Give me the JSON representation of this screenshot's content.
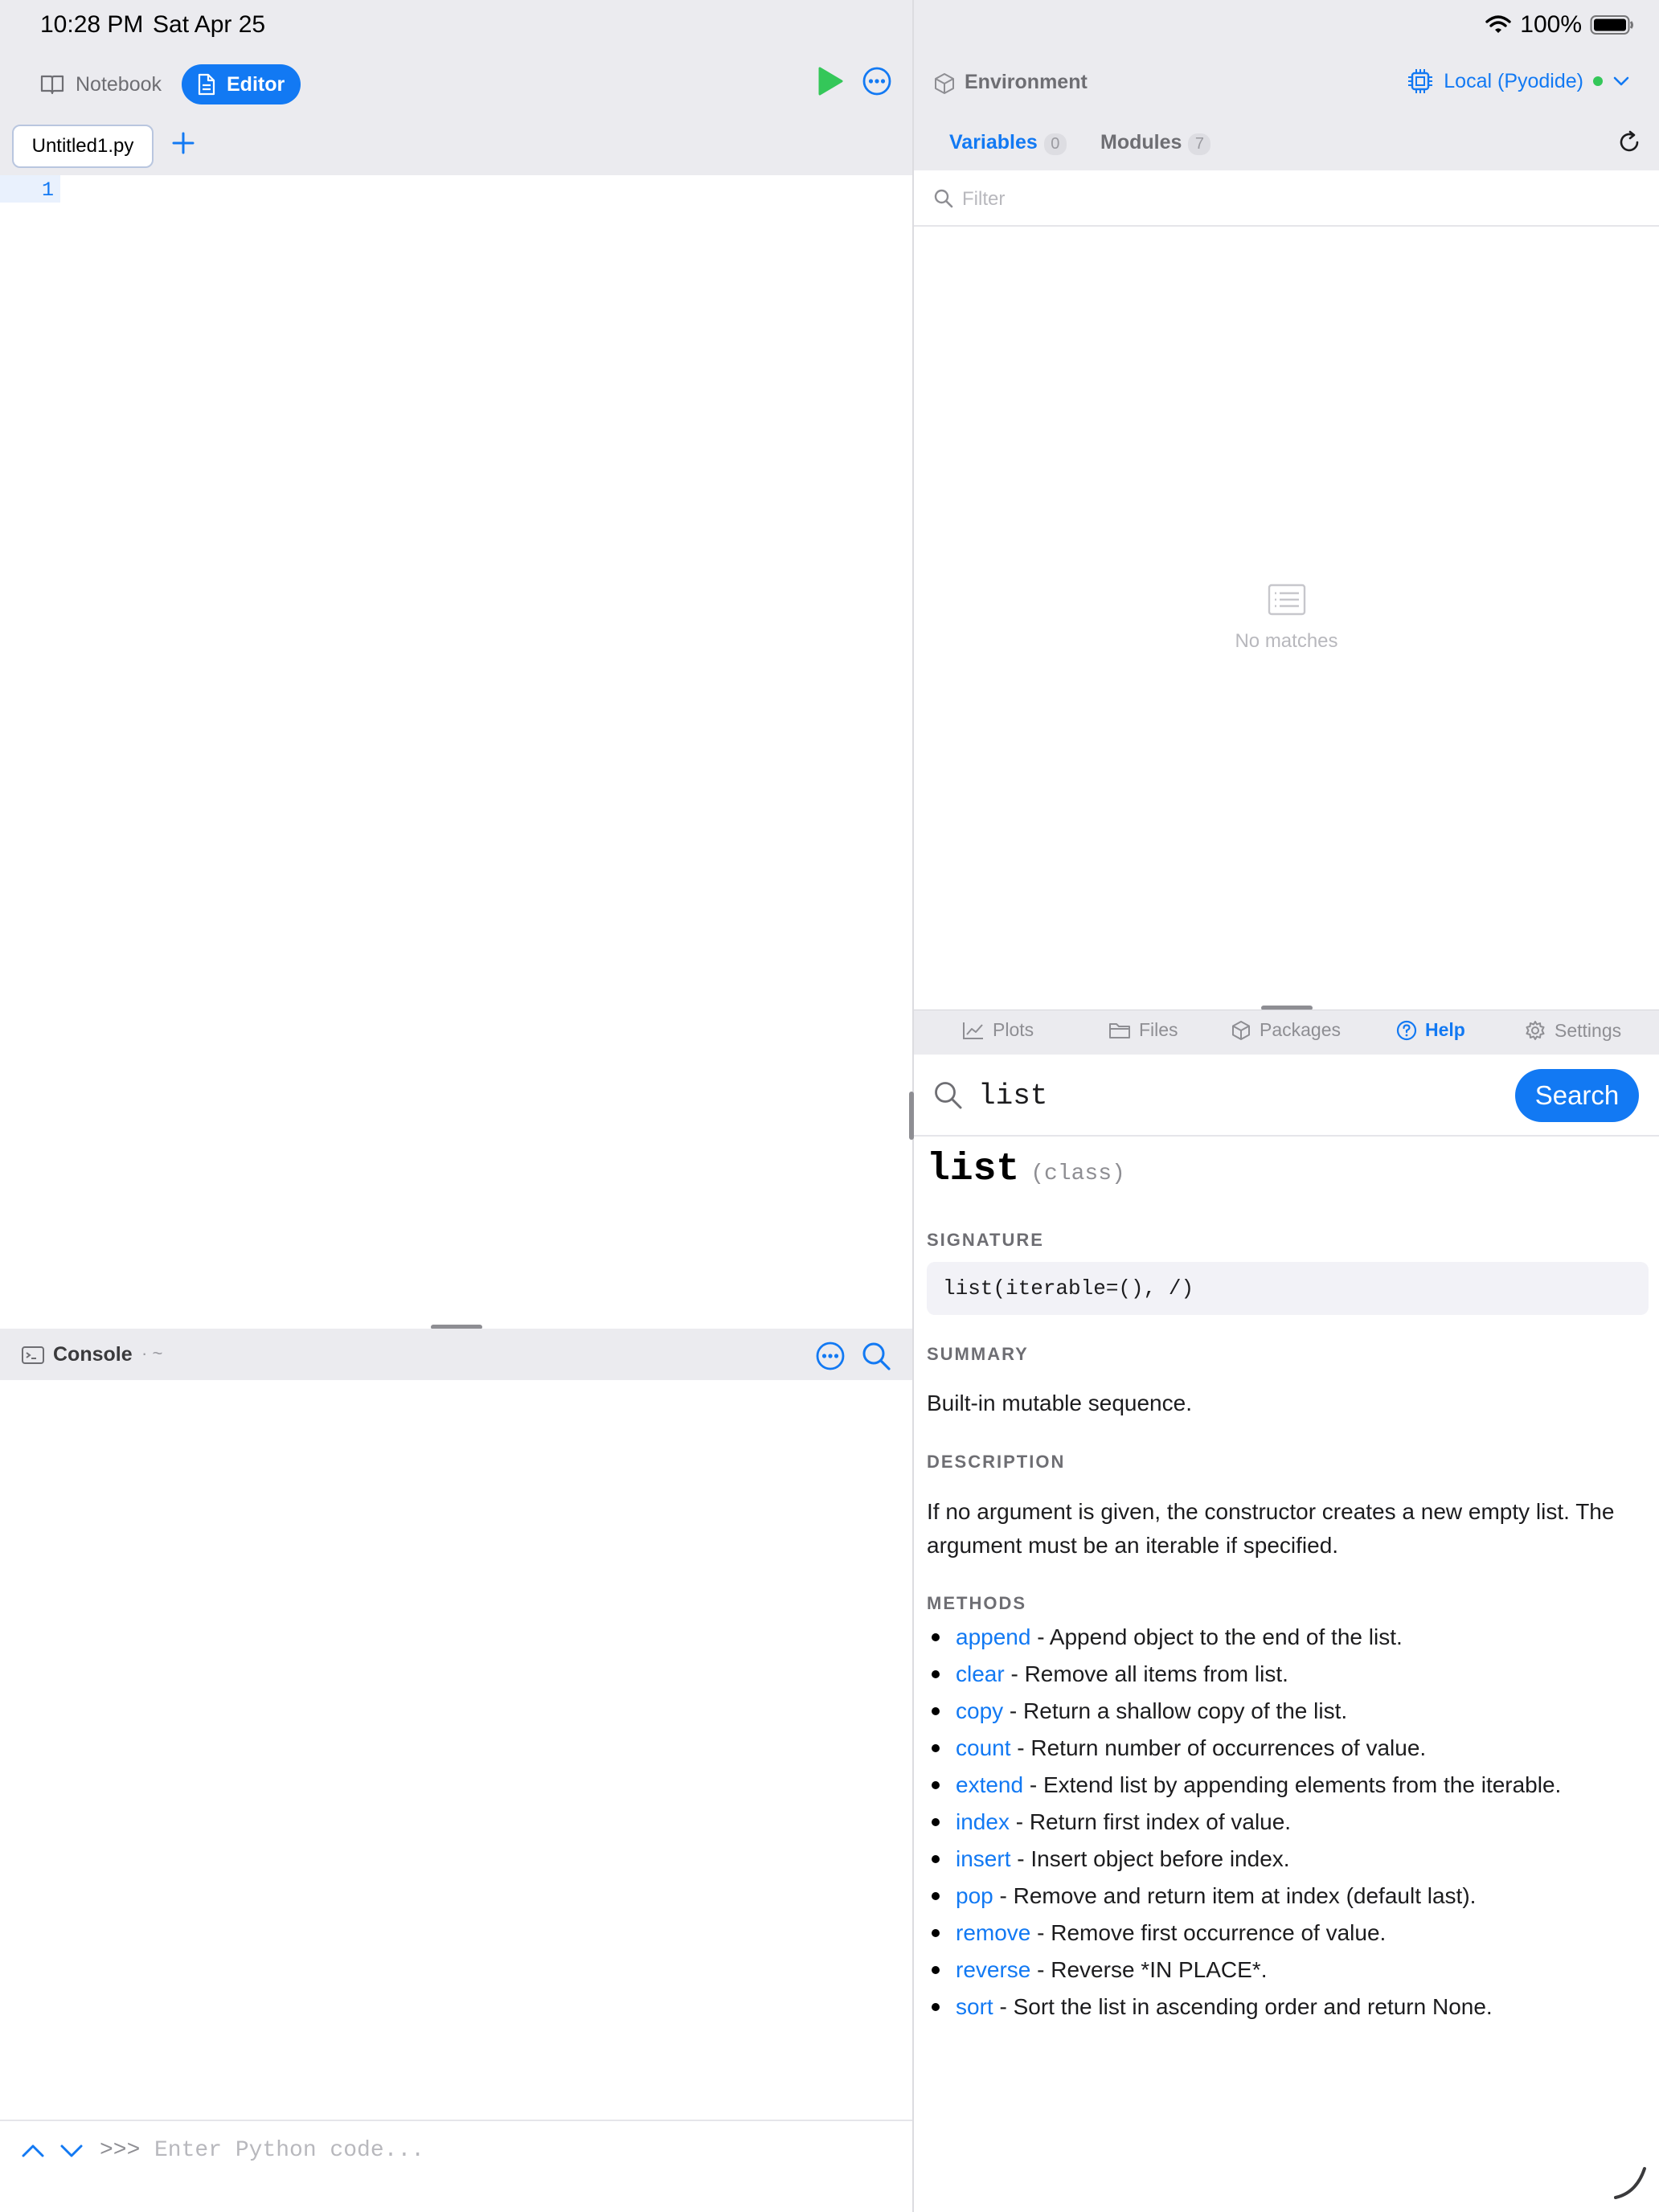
{
  "status_bar": {
    "time": "10:28 PM",
    "date": "Sat Apr 25",
    "battery": "100%"
  },
  "editor_pane": {
    "mode_tabs": [
      {
        "label": "Notebook",
        "active": false
      },
      {
        "label": "Editor",
        "active": true
      }
    ],
    "file_tab": "Untitled1.py",
    "line_numbers": [
      "1"
    ],
    "console": {
      "title": "Console",
      "path": "· ~",
      "prompt": ">>>",
      "placeholder": "Enter Python code..."
    }
  },
  "environment": {
    "title": "Environment",
    "kernel": "Local (Pyodide)",
    "kernel_status_color": "#34c759",
    "tabs": [
      {
        "label": "Variables",
        "count": "0",
        "active": true
      },
      {
        "label": "Modules",
        "count": "7",
        "active": false
      }
    ],
    "filter_placeholder": "Filter",
    "empty_message": "No matches"
  },
  "bottom_tabs": [
    {
      "label": "Plots",
      "icon": "chart-icon",
      "active": false
    },
    {
      "label": "Files",
      "icon": "folder-icon",
      "active": false
    },
    {
      "label": "Packages",
      "icon": "package-icon",
      "active": false
    },
    {
      "label": "Help",
      "icon": "help-icon",
      "active": true
    },
    {
      "label": "Settings",
      "icon": "gear-icon",
      "active": false
    }
  ],
  "help": {
    "query": "list",
    "search_button": "Search",
    "name": "list",
    "kind": "(class)",
    "signature_label": "SIGNATURE",
    "signature": "list(iterable=(), /)",
    "summary_label": "SUMMARY",
    "summary": "Built-in mutable sequence.",
    "description_label": "DESCRIPTION",
    "description": "If no argument is given, the constructor creates a new empty list. The argument must be an iterable if specified.",
    "methods_label": "METHODS",
    "methods": [
      {
        "name": "append",
        "desc": " - Append object to the end of the list."
      },
      {
        "name": "clear",
        "desc": " - Remove all items from list."
      },
      {
        "name": "copy",
        "desc": " - Return a shallow copy of the list."
      },
      {
        "name": "count",
        "desc": " - Return number of occurrences of value."
      },
      {
        "name": "extend",
        "desc": " - Extend list by appending elements from the iterable."
      },
      {
        "name": "index",
        "desc": " - Return first index of value."
      },
      {
        "name": "insert",
        "desc": " - Insert object before index."
      },
      {
        "name": "pop",
        "desc": " - Remove and return item at index (default last)."
      },
      {
        "name": "remove",
        "desc": " - Remove first occurrence of value."
      },
      {
        "name": "reverse",
        "desc": " - Reverse *IN PLACE*."
      },
      {
        "name": "sort",
        "desc": " - Sort the list in ascending order and return None."
      }
    ]
  },
  "colors": {
    "accent": "#1279f3",
    "run": "#34c759",
    "chrome": "#ebebef"
  }
}
